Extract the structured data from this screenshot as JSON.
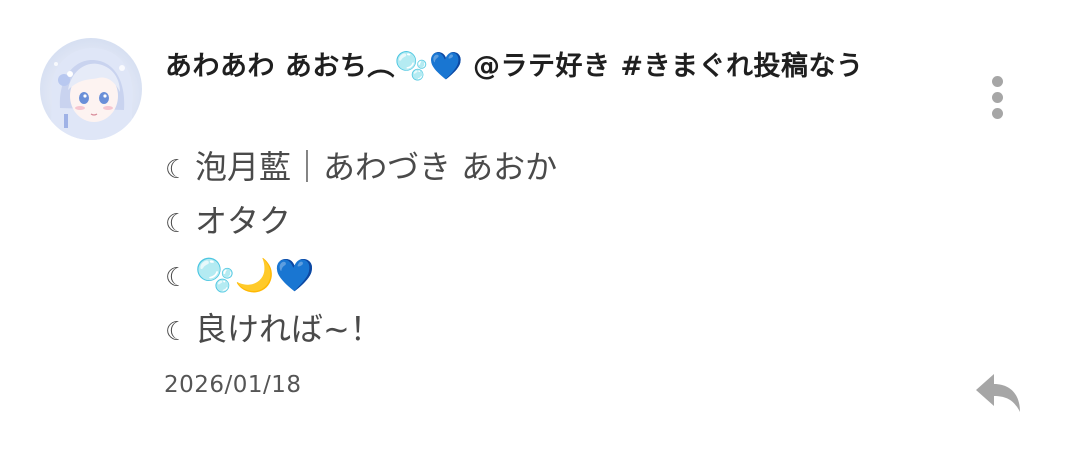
{
  "post": {
    "display_name": "あわあわ あおち︵🫧💙 @ラテ好き #きまぐれ投稿なう",
    "bio_lines": [
      {
        "marker": "☾",
        "text": "泡月藍｜あわづき あおか"
      },
      {
        "marker": "☾",
        "text": "オタク"
      },
      {
        "marker": "☾",
        "text": "🫧🌙💙"
      },
      {
        "marker": "☾",
        "text": "良ければ~！"
      }
    ],
    "date": "2026/01/18"
  },
  "icons": {
    "more": "more-vertical-icon",
    "reply": "reply-arrow-icon",
    "avatar": "user-avatar-image"
  },
  "colors": {
    "icon_gray": "#a6a6a6",
    "text_primary": "#1f1f1f",
    "text_secondary": "#4a4a4a",
    "bubble_blue": "#7fc6f0",
    "heart_blue": "#1e6fe0",
    "moon_yellow": "#f2c230"
  }
}
